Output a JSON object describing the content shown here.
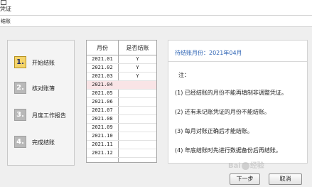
{
  "window": {
    "title": "凭证"
  },
  "subtitle": "结账",
  "steps": [
    {
      "number": "1.",
      "label": "开始结账",
      "active": true
    },
    {
      "number": "2.",
      "label": "核对账簿",
      "active": false
    },
    {
      "number": "3.",
      "label": "月度工作报告",
      "active": false
    },
    {
      "number": "4.",
      "label": "完成结账",
      "active": false
    }
  ],
  "month_table": {
    "headers": [
      "月份",
      "是否结账"
    ],
    "rows": [
      {
        "month": "2021.01",
        "closed": "Y"
      },
      {
        "month": "2021.02",
        "closed": "Y"
      },
      {
        "month": "2021.03",
        "closed": "Y"
      },
      {
        "month": "2021.04",
        "closed": "",
        "selected": true
      },
      {
        "month": "2021.05",
        "closed": ""
      },
      {
        "month": "2021.06",
        "closed": ""
      },
      {
        "month": "2021.07",
        "closed": ""
      },
      {
        "month": "2021.08",
        "closed": ""
      },
      {
        "month": "2021.09",
        "closed": ""
      },
      {
        "month": "2021.10",
        "closed": ""
      },
      {
        "month": "2021.11",
        "closed": ""
      },
      {
        "month": "2021.12",
        "closed": ""
      }
    ]
  },
  "info": {
    "pending_month": "待结账月份：2021年04月",
    "note_title": "注：",
    "notes": [
      "(1) 已经结账的月份不能再填制非调整凭证。",
      "(2) 还有未记账凭证的月份不能结账。",
      "(3) 每月对账正确后才能结账。",
      "(4) 年底结账时先进行数据备份后再结账。"
    ]
  },
  "buttons": {
    "next": "下一步",
    "cancel": "取消"
  },
  "watermark": {
    "left": "Bai",
    "right": "经验"
  },
  "colors": {
    "active_step": "#f4d46b",
    "inactive_step": "#b9b9b9",
    "selected_row": "#f9e4e6",
    "pending_text": "#2a61b3"
  }
}
